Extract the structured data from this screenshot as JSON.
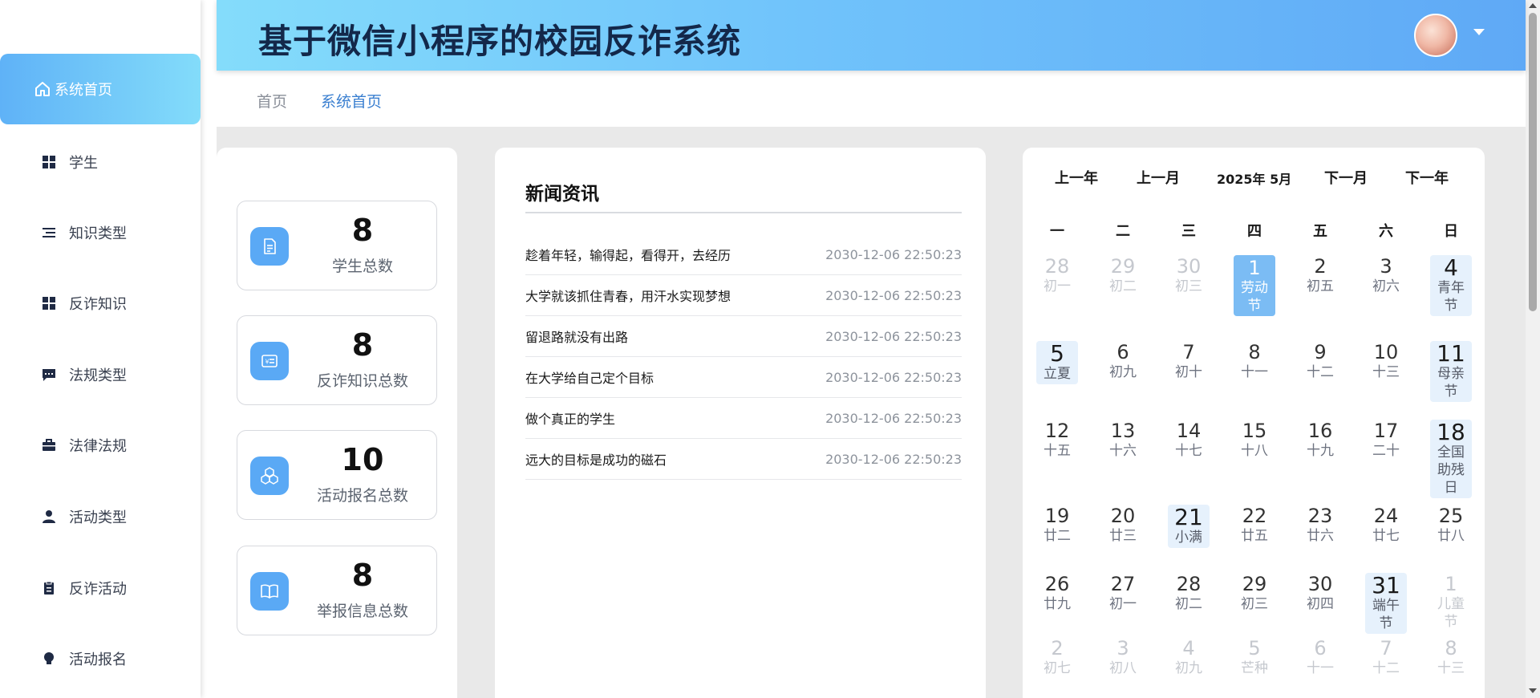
{
  "app": {
    "title": "基于微信小程序的校园反诈系统"
  },
  "sidebar": {
    "items": [
      {
        "label": "系统首页",
        "icon": "home-icon",
        "active": true
      },
      {
        "label": "学生",
        "icon": "grid-icon"
      },
      {
        "label": "知识类型",
        "icon": "list-icon"
      },
      {
        "label": "反诈知识",
        "icon": "grid-icon"
      },
      {
        "label": "法规类型",
        "icon": "chat-icon"
      },
      {
        "label": "法律法规",
        "icon": "briefcase-icon"
      },
      {
        "label": "活动类型",
        "icon": "user-icon"
      },
      {
        "label": "反诈活动",
        "icon": "clipboard-icon"
      },
      {
        "label": "活动报名",
        "icon": "bulb-icon"
      }
    ]
  },
  "breadcrumb": {
    "home": "首页",
    "current": "系统首页"
  },
  "stats": [
    {
      "value": "8",
      "label": "学生总数",
      "icon": "document-icon"
    },
    {
      "value": "8",
      "label": "反诈知识总数",
      "icon": "id-card-icon"
    },
    {
      "value": "10",
      "label": "活动报名总数",
      "icon": "cubes-icon"
    },
    {
      "value": "8",
      "label": "举报信息总数",
      "icon": "book-icon"
    }
  ],
  "news": {
    "title": "新闻资讯",
    "items": [
      {
        "text": "趁着年轻，输得起，看得开，去经历",
        "time": "2030-12-06 22:50:23"
      },
      {
        "text": "大学就该抓住青春，用汗水实现梦想",
        "time": "2030-12-06 22:50:23"
      },
      {
        "text": "留退路就没有出路",
        "time": "2030-12-06 22:50:23"
      },
      {
        "text": "在大学给自己定个目标",
        "time": "2030-12-06 22:50:23"
      },
      {
        "text": "做个真正的学生",
        "time": "2030-12-06 22:50:23"
      },
      {
        "text": "远大的目标是成功的磁石",
        "time": "2030-12-06 22:50:23"
      }
    ]
  },
  "calendar": {
    "prev_year": "上一年",
    "prev_month": "上一月",
    "month_label": "2025年 5月",
    "next_month": "下一月",
    "next_year": "下一年",
    "weekdays": [
      "一",
      "二",
      "三",
      "四",
      "五",
      "六",
      "日"
    ],
    "weeks": [
      [
        {
          "d": "28",
          "s": "初一",
          "muted": true
        },
        {
          "d": "29",
          "s": "初二",
          "muted": true
        },
        {
          "d": "30",
          "s": "初三",
          "muted": true
        },
        {
          "d": "1",
          "s": "劳动节",
          "today": true
        },
        {
          "d": "2",
          "s": "初五"
        },
        {
          "d": "3",
          "s": "初六"
        },
        {
          "d": "4",
          "s": "青年节",
          "festival": true
        }
      ],
      [
        {
          "d": "5",
          "s": "立夏",
          "festival": true
        },
        {
          "d": "6",
          "s": "初九"
        },
        {
          "d": "7",
          "s": "初十"
        },
        {
          "d": "8",
          "s": "十一"
        },
        {
          "d": "9",
          "s": "十二"
        },
        {
          "d": "10",
          "s": "十三"
        },
        {
          "d": "11",
          "s": "母亲节",
          "festival": true
        }
      ],
      [
        {
          "d": "12",
          "s": "十五"
        },
        {
          "d": "13",
          "s": "十六"
        },
        {
          "d": "14",
          "s": "十七"
        },
        {
          "d": "15",
          "s": "十八"
        },
        {
          "d": "16",
          "s": "十九"
        },
        {
          "d": "17",
          "s": "二十"
        },
        {
          "d": "18",
          "s": "全国助残日",
          "festival": true
        }
      ],
      [
        {
          "d": "19",
          "s": "廿二"
        },
        {
          "d": "20",
          "s": "廿三"
        },
        {
          "d": "21",
          "s": "小满",
          "festival": true
        },
        {
          "d": "22",
          "s": "廿五"
        },
        {
          "d": "23",
          "s": "廿六"
        },
        {
          "d": "24",
          "s": "廿七"
        },
        {
          "d": "25",
          "s": "廿八"
        }
      ],
      [
        {
          "d": "26",
          "s": "廿九"
        },
        {
          "d": "27",
          "s": "初一"
        },
        {
          "d": "28",
          "s": "初二"
        },
        {
          "d": "29",
          "s": "初三"
        },
        {
          "d": "30",
          "s": "初四"
        },
        {
          "d": "31",
          "s": "端午节",
          "festival": true
        },
        {
          "d": "1",
          "s": "儿童节",
          "muted": true
        }
      ],
      [
        {
          "d": "2",
          "s": "初七",
          "muted": true
        },
        {
          "d": "3",
          "s": "初八",
          "muted": true
        },
        {
          "d": "4",
          "s": "初九",
          "muted": true
        },
        {
          "d": "5",
          "s": "芒种",
          "muted": true
        },
        {
          "d": "6",
          "s": "十一",
          "muted": true
        },
        {
          "d": "7",
          "s": "十二",
          "muted": true
        },
        {
          "d": "8",
          "s": "十三",
          "muted": true
        }
      ]
    ]
  },
  "colors": {
    "accent": "#5aa9f5",
    "header_gradient_start": "#84dcfb",
    "header_gradient_end": "#5fa9f6",
    "title_text": "#13284a",
    "content_bg": "#e9e9e9"
  }
}
